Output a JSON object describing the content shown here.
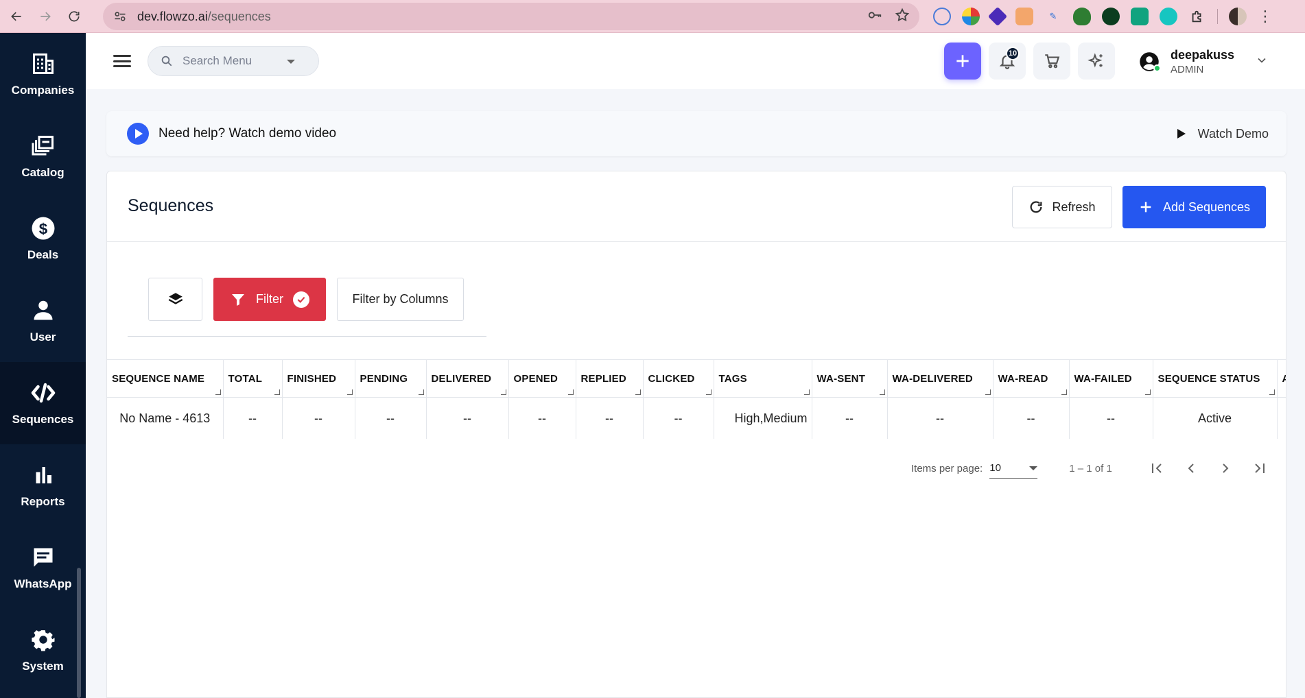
{
  "browser": {
    "url_host": "dev.flowzo.ai",
    "url_path": "/sequences"
  },
  "sidebar": {
    "items": [
      {
        "label": "Companies",
        "icon": "companies-icon"
      },
      {
        "label": "Catalog",
        "icon": "catalog-icon"
      },
      {
        "label": "Deals",
        "icon": "dollar-icon"
      },
      {
        "label": "User",
        "icon": "user-icon"
      },
      {
        "label": "Sequences",
        "icon": "sequences-icon",
        "active": true
      },
      {
        "label": "Reports",
        "icon": "bar-chart-icon"
      },
      {
        "label": "WhatsApp",
        "icon": "chat-icon"
      },
      {
        "label": "System",
        "icon": "gear-icon"
      }
    ]
  },
  "header": {
    "search_placeholder": "Search Menu",
    "notification_count": "10",
    "user_name": "deepakuss",
    "user_role": "ADMIN"
  },
  "help": {
    "text": "Need help? Watch demo video",
    "watch_label": "Watch Demo"
  },
  "page": {
    "title": "Sequences",
    "refresh_label": "Refresh",
    "add_label": "Add Sequences",
    "filter_label": "Filter",
    "filter_columns_label": "Filter by Columns"
  },
  "table": {
    "columns": [
      "SEQUENCE NAME",
      "TOTAL",
      "FINISHED",
      "PENDING",
      "DELIVERED",
      "OPENED",
      "REPLIED",
      "CLICKED",
      "TAGS",
      "WA-SENT",
      "WA-DELIVERED",
      "WA-READ",
      "WA-FAILED",
      "SEQUENCE STATUS",
      "A"
    ],
    "rows": [
      [
        "No Name - 4613",
        "--",
        "--",
        "--",
        "--",
        "--",
        "--",
        "--",
        "High,Medium",
        "--",
        "--",
        "--",
        "--",
        "Active",
        ""
      ]
    ]
  },
  "pagination": {
    "items_per_page_label": "Items per page:",
    "items_per_page": "10",
    "range": "1 – 1 of 1"
  },
  "colors": {
    "sidebar_bg": "#0a1b33",
    "primary": "#2557f0",
    "accent": "#6c63ff",
    "filter_red": "#dc3545"
  }
}
